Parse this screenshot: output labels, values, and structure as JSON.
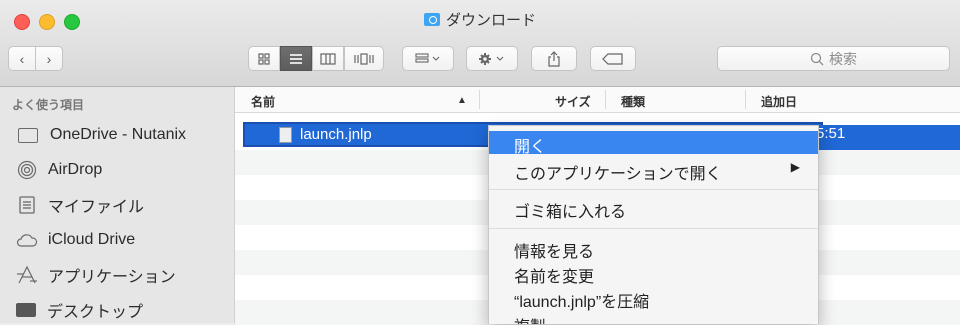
{
  "window": {
    "title": "ダウンロード"
  },
  "toolbar": {
    "back": "‹",
    "forward": "›",
    "search_placeholder": "検索"
  },
  "sidebar": {
    "header": "よく使う項目",
    "items": [
      {
        "label": "OneDrive - Nutanix",
        "icon": "folder-icon"
      },
      {
        "label": "AirDrop",
        "icon": "airdrop-icon"
      },
      {
        "label": "マイファイル",
        "icon": "all-files-icon"
      },
      {
        "label": "iCloud Drive",
        "icon": "cloud-icon"
      },
      {
        "label": "アプリケーション",
        "icon": "applications-icon"
      },
      {
        "label": "デスクトップ",
        "icon": "desktop-icon"
      }
    ]
  },
  "list": {
    "columns": {
      "name": "名前",
      "size": "サイズ",
      "kind": "種類",
      "date_added": "追加日"
    },
    "rows": [
      {
        "name": "launch.jnlp",
        "date_added_fragment": "5:51"
      }
    ]
  },
  "context_menu": {
    "items": [
      {
        "label": "開く"
      },
      {
        "label": "このアプリケーションで開く"
      },
      {
        "label": "ゴミ箱に入れる"
      },
      {
        "label": "情報を見る"
      },
      {
        "label": "名前を変更"
      },
      {
        "label": "“launch.jnlp”を圧縮"
      },
      {
        "label": "複製"
      }
    ]
  }
}
